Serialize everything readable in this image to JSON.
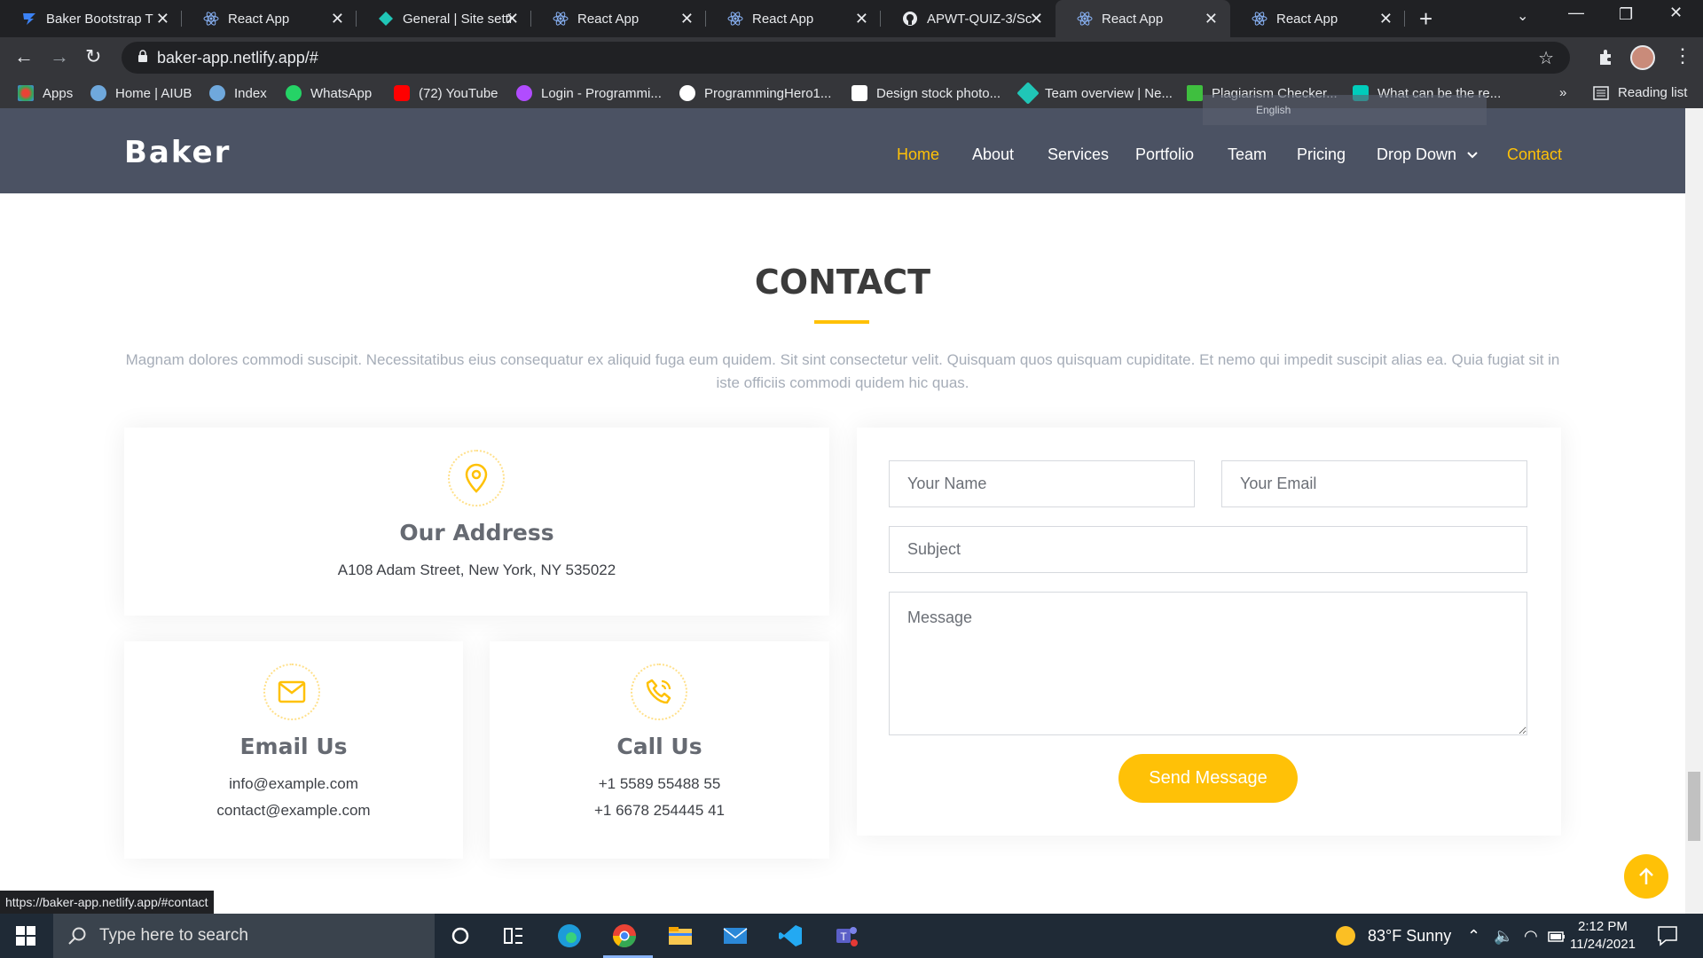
{
  "browser": {
    "tabs": [
      {
        "label": "Baker Bootstrap T",
        "icon": "baker-favicon",
        "active": false
      },
      {
        "label": "React App",
        "icon": "react-icon",
        "active": false
      },
      {
        "label": "General | Site setti",
        "icon": "netlify-icon",
        "active": false
      },
      {
        "label": "React App",
        "icon": "react-icon",
        "active": false
      },
      {
        "label": "React App",
        "icon": "react-icon",
        "active": false
      },
      {
        "label": "APWT-QUIZ-3/Sc",
        "icon": "github-icon",
        "active": false
      },
      {
        "label": "React App",
        "icon": "react-icon",
        "active": true
      },
      {
        "label": "React App",
        "icon": "react-icon",
        "active": false
      }
    ],
    "url": "baker-app.netlify.app/#",
    "bookmarks": [
      {
        "label": "Apps",
        "icon": "apps-grid-icon",
        "color": "#ea4335"
      },
      {
        "label": "Home | AIUB",
        "icon": "aiub-icon",
        "color": "#6fa8dc"
      },
      {
        "label": "Index",
        "icon": "aiub-icon",
        "color": "#6fa8dc"
      },
      {
        "label": "WhatsApp",
        "icon": "whatsapp-icon",
        "color": "#25d366"
      },
      {
        "label": "(72) YouTube",
        "icon": "youtube-icon",
        "color": "#ff0000"
      },
      {
        "label": "Login - Programmi...",
        "icon": "programming-hero-icon",
        "color": "#b14cff"
      },
      {
        "label": "ProgrammingHero1...",
        "icon": "github-icon",
        "color": "#ffffff"
      },
      {
        "label": "Design stock photo...",
        "icon": "shutterstock-icon",
        "color": "#ffffff"
      },
      {
        "label": "Team overview | Ne...",
        "icon": "netlify-icon",
        "color": "#20c6b7"
      },
      {
        "label": "Plagiarism Checker...",
        "icon": "plagiarism-icon",
        "color": "#3fbf3f"
      },
      {
        "label": "What can be the re...",
        "icon": "researchgate-icon",
        "color": "#00ccbb"
      }
    ],
    "more_bookmarks": "»",
    "reading_list": "Reading list",
    "translate_lang": "English",
    "status_url": "https://baker-app.netlify.app/#contact"
  },
  "site": {
    "logo": "Baker",
    "nav": [
      {
        "label": "Home",
        "active": true
      },
      {
        "label": "About",
        "active": false
      },
      {
        "label": "Services",
        "active": false
      },
      {
        "label": "Portfolio",
        "active": false
      },
      {
        "label": "Team",
        "active": false
      },
      {
        "label": "Pricing",
        "active": false
      },
      {
        "label": "Drop Down",
        "active": false
      },
      {
        "label": "Contact",
        "active": true
      }
    ],
    "accent_color": "#ffc107",
    "header_color": "#4b5263"
  },
  "contact": {
    "title": "CONTACT",
    "description": "Magnam dolores commodi suscipit. Necessitatibus eius consequatur ex aliquid fuga eum quidem. Sit sint consectetur velit. Quisquam quos quisquam cupiditate. Et nemo qui impedit suscipit alias ea. Quia fugiat sit in iste officiis commodi quidem hic quas.",
    "address": {
      "title": "Our Address",
      "text": "A108 Adam Street, New York, NY 535022",
      "icon": "map-pin-icon"
    },
    "email": {
      "title": "Email Us",
      "lines": [
        "info@example.com",
        "contact@example.com"
      ],
      "icon": "envelope-icon"
    },
    "phone": {
      "title": "Call Us",
      "lines": [
        "+1 5589 55488 55",
        "+1 6678 254445 41"
      ],
      "icon": "phone-icon"
    },
    "form": {
      "name_placeholder": "Your Name",
      "email_placeholder": "Your Email",
      "subject_placeholder": "Subject",
      "message_placeholder": "Message",
      "submit_label": "Send Message"
    }
  },
  "taskbar": {
    "search_placeholder": "Type here to search",
    "weather": "83°F  Sunny",
    "time": "2:12 PM",
    "date": "11/24/2021"
  }
}
